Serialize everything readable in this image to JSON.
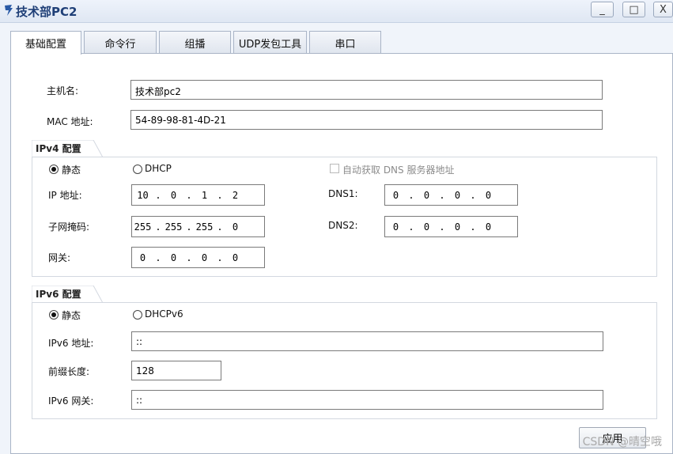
{
  "window": {
    "title": "技术部PC2",
    "app_icon": "network-pc-icon",
    "controls": {
      "minimize": "_",
      "maximize": "□",
      "close": "X"
    }
  },
  "tabs": [
    {
      "label": "基础配置",
      "active": true
    },
    {
      "label": "命令行"
    },
    {
      "label": "组播"
    },
    {
      "label": "UDP发包工具"
    },
    {
      "label": "串口"
    }
  ],
  "host": {
    "hostname_label": "主机名:",
    "hostname_value": "技术部pc2",
    "mac_label": "MAC 地址:",
    "mac_value": "54-89-98-81-4D-21"
  },
  "ipv4": {
    "group_label": "IPv4 配置",
    "static_label": "静态",
    "dhcp_label": "DHCP",
    "auto_dns_label": "自动获取 DNS 服务器地址",
    "ip_label": "IP 地址:",
    "ip": [
      "10",
      "0",
      "1",
      "2"
    ],
    "mask_label": "子网掩码:",
    "mask": [
      "255",
      "255",
      "255",
      "0"
    ],
    "gateway_label": "网关:",
    "gateway": [
      "0",
      "0",
      "0",
      "0"
    ],
    "dns1_label": "DNS1:",
    "dns1": [
      "0",
      "0",
      "0",
      "0"
    ],
    "dns2_label": "DNS2:",
    "dns2": [
      "0",
      "0",
      "0",
      "0"
    ]
  },
  "ipv6": {
    "group_label": "IPv6 配置",
    "static_label": "静态",
    "dhcp_label": "DHCPv6",
    "ip_label": "IPv6 地址:",
    "ip_value": "::",
    "prefix_label": "前缀长度:",
    "prefix_value": "128",
    "gateway_label": "IPv6 网关:",
    "gateway_value": "::"
  },
  "apply_label": "应用",
  "watermark": "CSDN @晴空哦"
}
